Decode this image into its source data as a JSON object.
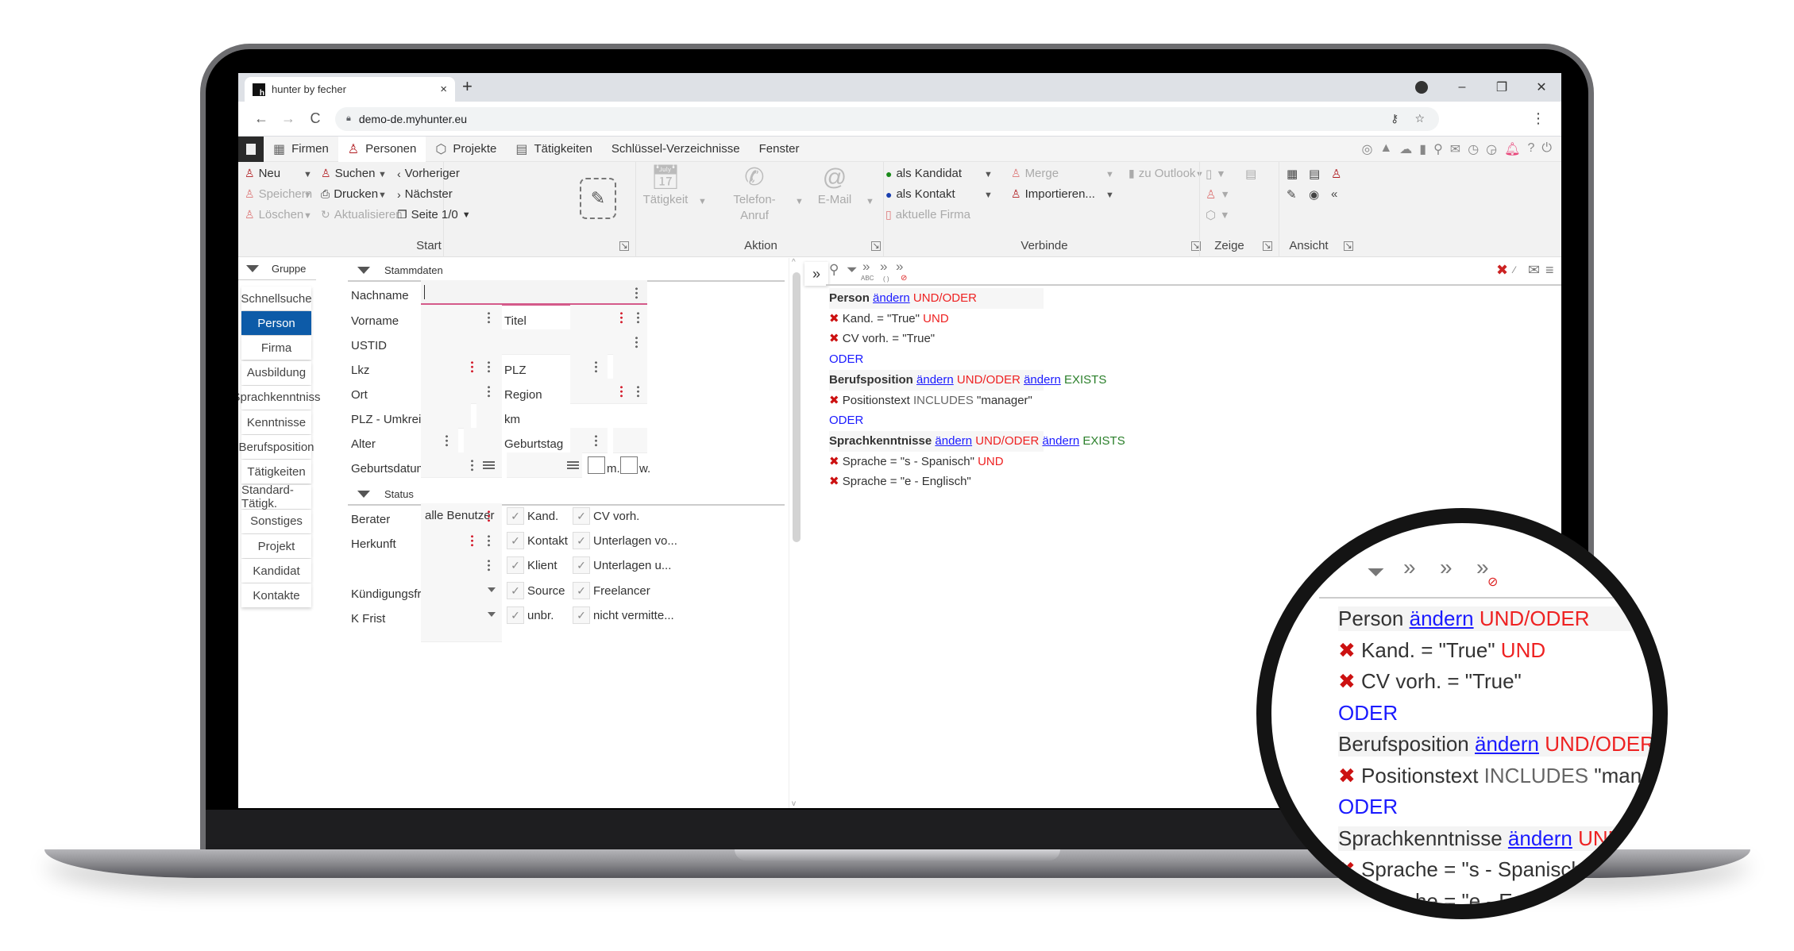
{
  "browser": {
    "tab_title": "hunter by fecher",
    "tab_close": "×",
    "new_tab": "+",
    "url": "demo-de.myhunter.eu",
    "back": "←",
    "forward": "→",
    "reload": "C",
    "window_controls": {
      "minimize": "–",
      "maximize": "❐",
      "close": "✕"
    },
    "menu": "⋮",
    "key_icon": "⚷",
    "star_icon": "☆"
  },
  "appbar": {
    "tabs": [
      {
        "label": "Firmen",
        "icon": "building-search-icon"
      },
      {
        "label": "Personen",
        "icon": "person-search-icon",
        "active": true
      },
      {
        "label": "Projekte",
        "icon": "box-search-icon"
      },
      {
        "label": "Tätigkeiten",
        "icon": "calendar-search-icon"
      },
      {
        "label": "Schlüssel-Verzeichnisse"
      },
      {
        "label": "Fenster"
      }
    ],
    "right_icons": [
      "compass-icon",
      "chart-icon",
      "cloud-icon",
      "outlook-icon",
      "search-icon",
      "sms-icon",
      "clock-refresh-icon",
      "clock-pause-icon",
      "bell-icon",
      "help-icon",
      "power-icon"
    ]
  },
  "ribbon": {
    "start": {
      "title": "Start",
      "items": [
        {
          "label": "Neu",
          "enabled": true
        },
        {
          "label": "Speichern",
          "enabled": false
        },
        {
          "label": "Löschen",
          "enabled": false
        },
        {
          "label": "Suchen",
          "enabled": true
        },
        {
          "label": "Drucken",
          "enabled": true
        },
        {
          "label": "Aktualisieren",
          "enabled": false
        },
        {
          "label": "Vorheriger",
          "enabled": true
        },
        {
          "label": "Nächster",
          "enabled": true
        },
        {
          "label": "Seite 1/0",
          "enabled": true
        }
      ]
    },
    "aktion": {
      "title": "Aktion",
      "items": [
        {
          "label": "Tätigkeit"
        },
        {
          "label": "Telefon-",
          "label2": "Anruf"
        },
        {
          "label": "E-Mail"
        }
      ]
    },
    "verbinde": {
      "title": "Verbinde",
      "items": [
        {
          "label": "als Kandidat",
          "enabled": true
        },
        {
          "label": "als Kontakt",
          "enabled": true
        },
        {
          "label": "aktuelle Firma",
          "enabled": false
        },
        {
          "label": "Merge",
          "enabled": false
        },
        {
          "label": "Importieren...",
          "enabled": true
        },
        {
          "label": "zu Outlook",
          "enabled": false
        }
      ]
    },
    "zeige": {
      "title": "Zeige"
    },
    "ansicht": {
      "title": "Ansicht"
    }
  },
  "groups": {
    "header": "Gruppe",
    "items": [
      "Schnellsuche",
      "Person",
      "Firma",
      "Ausbildung",
      "Sprachkenntniss",
      "Kenntnisse",
      "Berufsposition",
      "Tätigkeiten",
      "Standard-Tätigk.",
      "Sonstiges",
      "Projekt",
      "Kandidat",
      "Kontakte"
    ],
    "active": "Person"
  },
  "form": {
    "stammdaten_header": "Stammdaten",
    "status_header": "Status",
    "labels": {
      "nachname": "Nachname",
      "vorname": "Vorname",
      "titel": "Titel",
      "ustid": "USTID",
      "lkz": "Lkz",
      "plz": "PLZ",
      "ort": "Ort",
      "region": "Region",
      "plz_umkreis": "PLZ - Umkreis",
      "km": "km",
      "alter": "Alter",
      "geburtstag": "Geburtstag",
      "geburtsdatum": "Geburtsdatum",
      "m": "m.",
      "w": "w.",
      "berater": "Berater",
      "herkunft": "Herkunft",
      "kuendigungsfrist": "Kündigungsfr...",
      "k_frist": "K Frist"
    },
    "values": {
      "berater": "alle Benutzer"
    },
    "checkboxes_col1": [
      "Kand.",
      "Kontakt",
      "Klient",
      "Source",
      "unbr."
    ],
    "checkboxes_col2": [
      "CV vorh.",
      "Unterlagen vo...",
      "Unterlagen u...",
      "Freelancer",
      "nicht vermitte..."
    ]
  },
  "query": {
    "tool_icons": [
      "search-icon",
      "filter-icon",
      "abc-icon",
      "parentheses-icon",
      "clear-icon"
    ],
    "right_icons": [
      "delete-icon",
      "and-or-icon",
      "mail-icon",
      "menu-icon"
    ],
    "lines": [
      {
        "type": "head",
        "entity": "Person",
        "links": [
          "ändern"
        ],
        "op": "UND/ODER"
      },
      {
        "type": "cond",
        "text": "Kand. = \"True\"",
        "op": "UND"
      },
      {
        "type": "cond",
        "text": "CV vorh. = \"True\"",
        "op": ""
      },
      {
        "type": "join",
        "text": "ODER"
      },
      {
        "type": "head",
        "entity": "Berufsposition",
        "links": [
          "ändern",
          "ändern"
        ],
        "op": "UND/ODER",
        "exists": "EXISTS"
      },
      {
        "type": "cond",
        "text": "Positionstext",
        "keyword": "INCLUDES",
        "value": "\"manager\"",
        "op": ""
      },
      {
        "type": "join",
        "text": "ODER"
      },
      {
        "type": "head",
        "entity": "Sprachkenntnisse",
        "links": [
          "ändern",
          "ändern"
        ],
        "op": "UND/ODER",
        "exists": "EXISTS"
      },
      {
        "type": "cond",
        "text": "Sprache = \"s - Spanisch\"",
        "op": "UND"
      },
      {
        "type": "cond",
        "text": "Sprache = \"e - Englisch\"",
        "op": ""
      }
    ],
    "abc": "ABC",
    "parens": "( )",
    "expand": "»",
    "x_mark": "✖"
  },
  "colors": {
    "accent_blue": "#0d5ba8",
    "brand_red": "#b11c20",
    "link_blue": "#1a1aff",
    "op_red": "#e22222",
    "exists_green": "#2a7f2a"
  }
}
